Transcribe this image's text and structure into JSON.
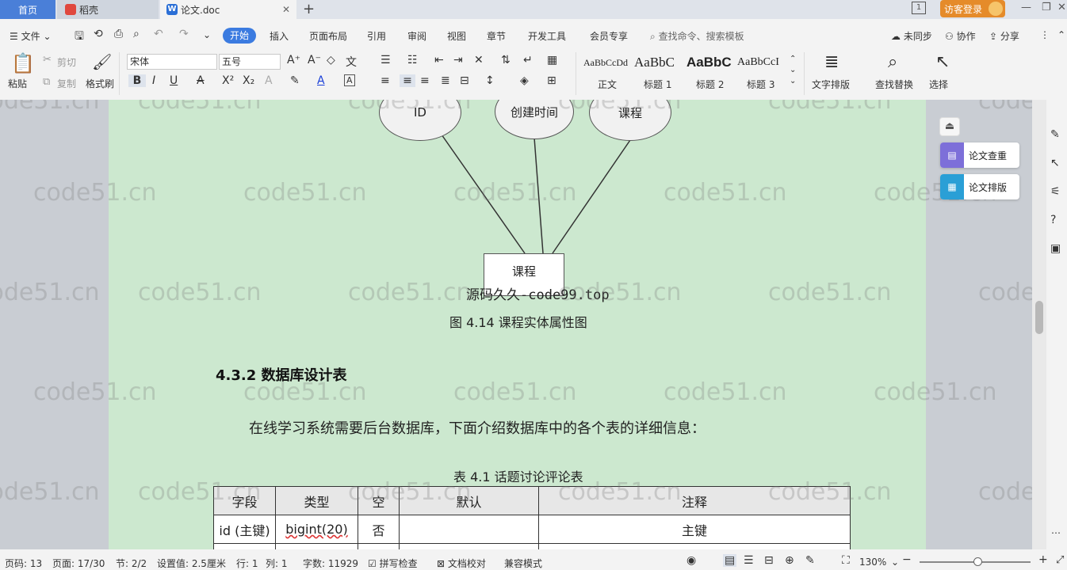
{
  "tabs": {
    "home": "首页",
    "straw": "稻壳",
    "doc": "论文.doc",
    "add": "+"
  },
  "window": {
    "page_indicator": "1",
    "login_label": "访客登录",
    "minimize": "—",
    "restore": "❐",
    "close": "✕"
  },
  "menu": {
    "file": "文件",
    "items": [
      "开始",
      "插入",
      "页面布局",
      "引用",
      "审阅",
      "视图",
      "章节",
      "开发工具",
      "会员专享"
    ],
    "search_placeholder": "查找命令、搜索模板",
    "sync": "未同步",
    "collab": "协作",
    "share": "分享"
  },
  "ribbon": {
    "paste": "粘贴",
    "cut": "剪切",
    "copy": "复制",
    "format_painter": "格式刷",
    "font_name": "宋体",
    "font_size": "五号",
    "style_names": [
      "正文",
      "标题 1",
      "标题 2",
      "标题 3"
    ],
    "style_previews": [
      "AaBbCcDd",
      "AaBbC",
      "AaBbC",
      "AaBbCcI"
    ],
    "text_layout": "文字排版",
    "find_replace": "查找替换",
    "select": "选择"
  },
  "document": {
    "ellipses": [
      "ID",
      "创建时间",
      "课程"
    ],
    "entity": "课程",
    "source_watermark": "源码久久-code99.top",
    "figure_caption": "图 4.14  课程实体属性图",
    "section_heading": "4.3.2 数据库设计表",
    "paragraph": "在线学习系统需要后台数据库，下面介绍数据库中的各个表的详细信息：",
    "table_caption": "表 4.1  话题讨论评论表",
    "table": {
      "headers": [
        "字段",
        "类型",
        "空",
        "默认",
        "注释"
      ],
      "rows": [
        [
          "id (主键)",
          "bigint(20)",
          "否",
          "",
          "主键"
        ]
      ]
    }
  },
  "watermark_text": "code51.cn",
  "side_panel": {
    "plagiarism": "论文查重",
    "layout": "论文排版"
  },
  "status": {
    "page_code": "页码: 13",
    "page": "页面: 17/30",
    "section": "节: 2/2",
    "setting": "设置值: 2.5厘米",
    "row": "行: 1",
    "col": "列: 1",
    "word_count": "字数: 11929",
    "spell_check": "拼写检查",
    "doc_proof": "文档校对",
    "compat_mode": "兼容模式",
    "zoom": "130%"
  },
  "colors": {
    "accent": "#3b7be0",
    "page_bg": "#cce8cf",
    "login": "#e58b2a"
  }
}
